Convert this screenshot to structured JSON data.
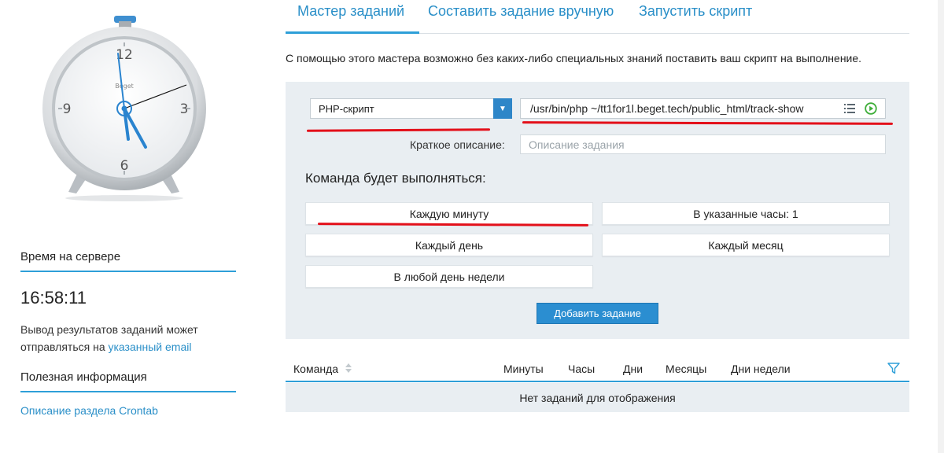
{
  "tabs": {
    "wizard": "Мастер заданий",
    "manual": "Составить задание вручную",
    "script": "Запустить скрипт"
  },
  "wizard": {
    "description": "С помощью этого мастера возможно без каких-либо специальных знаний поставить ваш скрипт на выполнение.",
    "type_value": "PHP-скрипт",
    "command_value": "/usr/bin/php ~/tt1for1l.beget.tech/public_html/track-show",
    "desc_label": "Краткое описание:",
    "desc_placeholder": "Описание задания",
    "exec_heading": "Команда будет выполняться:",
    "schedule": {
      "every_minute": "Каждую минуту",
      "hours": "В указанные часы: 1",
      "every_day": "Каждый день",
      "every_month": "Каждый месяц",
      "weekday": "В любой день недели"
    },
    "add_button": "Добавить задание"
  },
  "table": {
    "columns": [
      "Команда",
      "Минуты",
      "Часы",
      "Дни",
      "Месяцы",
      "Дни недели"
    ],
    "empty": "Нет заданий для отображения"
  },
  "sidebar": {
    "clock": {
      "numerals": [
        "12",
        "3",
        "6",
        "9"
      ],
      "brand": "Beget"
    },
    "time_heading": "Время на сервере",
    "server_time": "16:58:11",
    "output_note": "Вывод результатов заданий может отправляться на",
    "output_link": "указанный email",
    "info_heading": "Полезная информация",
    "crontab_link": "Описание раздела Crontab"
  },
  "colors": {
    "accent": "#2e9fd8",
    "link": "#2a8fc8",
    "panel_bg": "#e9eef2",
    "primary_button": "#2b8ed1",
    "annotation_red": "#e3101a"
  },
  "icons": [
    "clock-icon",
    "chevron-down-icon",
    "list-icon",
    "play-icon",
    "sort-icon",
    "filter-icon"
  ]
}
